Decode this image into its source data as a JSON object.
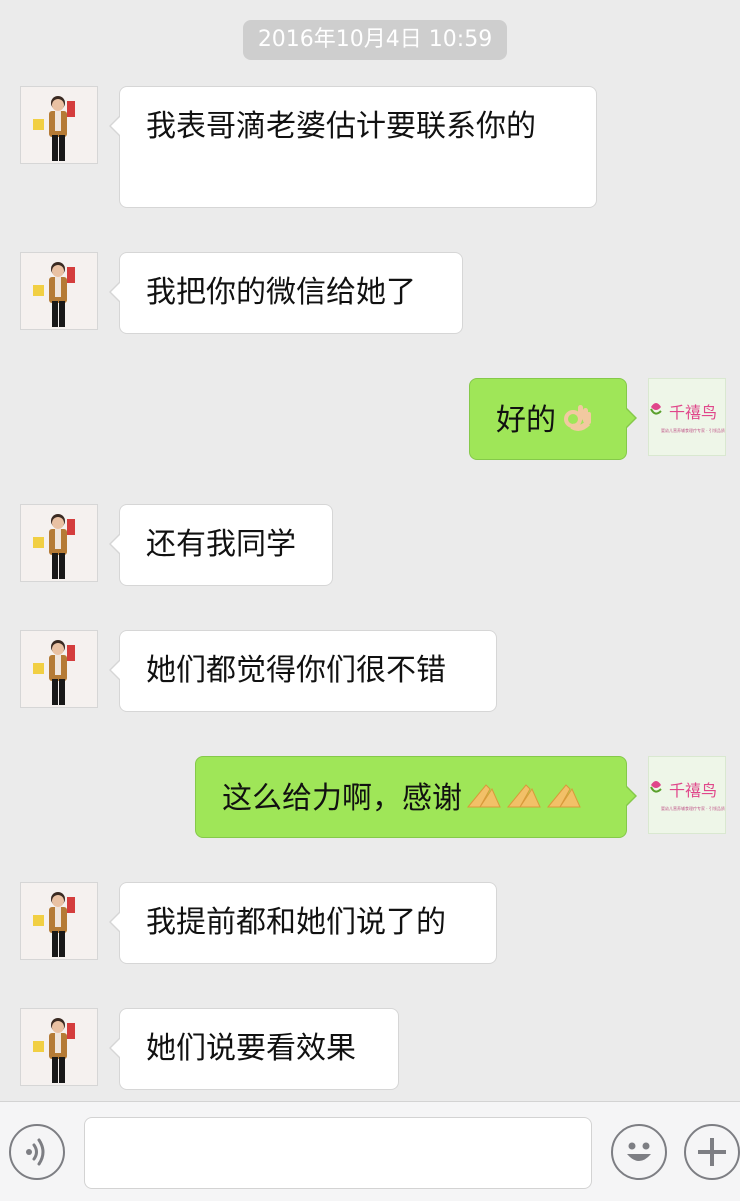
{
  "chat": {
    "timestamp": "2016年10月4日 10:59",
    "messages": [
      {
        "side": "left",
        "text": "我表哥滴老婆估计要联系你的"
      },
      {
        "side": "left",
        "text": "我把你的微信给她了"
      },
      {
        "side": "right",
        "text": "好的",
        "emoji": "ok-hand-emoji"
      },
      {
        "side": "left",
        "text": "还有我同学"
      },
      {
        "side": "left",
        "text": "她们都觉得你们很不错"
      },
      {
        "side": "right",
        "text": "这么给力啊，感谢",
        "emoji": "praying-hands-emoji x3"
      },
      {
        "side": "left",
        "text": "我提前都和她们说了的"
      },
      {
        "side": "left",
        "text": "她们说要看效果"
      }
    ]
  },
  "brand_avatar": {
    "name": "千禧鸟",
    "tagline": "婴幼儿营养辅食理疗专家 · 引领品质"
  },
  "colors": {
    "background": "#ebebeb",
    "bubble_self": "#9fe658",
    "bubble_other": "#ffffff",
    "timestamp_bg": "#cecece",
    "brand_pink": "#e0468a"
  },
  "toolbar": {
    "voice_icon": "voice-icon",
    "emoji_icon": "emoji-icon",
    "plus_icon": "plus-icon"
  }
}
